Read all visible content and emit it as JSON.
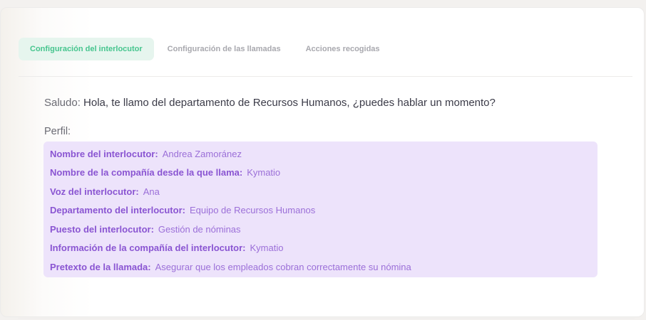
{
  "tabs": [
    {
      "label": "Configuración del interlocutor",
      "active": true
    },
    {
      "label": "Configuración de las llamadas",
      "active": false
    },
    {
      "label": "Acciones recogidas",
      "active": false
    }
  ],
  "greeting": {
    "label": "Saludo:",
    "text": "Hola, te llamo del departamento de Recursos Humanos, ¿puedes hablar un momento?"
  },
  "profile": {
    "title": "Perfil:",
    "rows": [
      {
        "key": "Nombre del interlocutor:",
        "value": "Andrea Zamoránez"
      },
      {
        "key": "Nombre de la compañía desde la que llama:",
        "value": "Kymatio"
      },
      {
        "key": "Voz del interlocutor:",
        "value": "Ana"
      },
      {
        "key": "Departamento del interlocutor:",
        "value": "Equipo de Recursos Humanos"
      },
      {
        "key": "Puesto del interlocutor:",
        "value": "Gestión de nóminas"
      },
      {
        "key": "Información de la compañía del interlocutor:",
        "value": "Kymatio"
      },
      {
        "key": "Pretexto de la llamada:",
        "value": "Asegurar que los empleados cobran correctamente su nómina"
      }
    ]
  },
  "colors": {
    "active_tab_bg": "#e6f5ee",
    "active_tab_text": "#46c58e",
    "profile_bg": "#ede3fb",
    "profile_key": "#8a55d2",
    "profile_value": "#9b6fd8"
  }
}
